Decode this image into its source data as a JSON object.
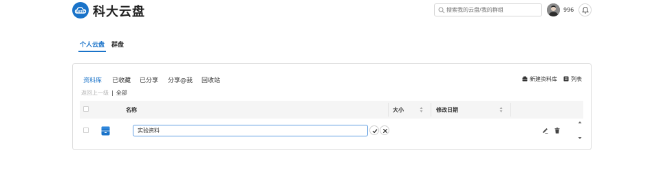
{
  "app": {
    "title": "科大云盘",
    "logo_icon": "cloud-disk-icon",
    "accent_color": "#1a73c9"
  },
  "header": {
    "search_placeholder": "搜索我的云盘/我的群组",
    "username": "996",
    "notification_icon": "bell-icon"
  },
  "top_tabs": [
    {
      "label": "个人云盘",
      "active": true
    },
    {
      "label": "群盘",
      "active": false
    }
  ],
  "sub_tabs": [
    {
      "label": "资料库",
      "active": true
    },
    {
      "label": "已收藏",
      "active": false
    },
    {
      "label": "已分享",
      "active": false
    },
    {
      "label": "分享@我",
      "active": false
    },
    {
      "label": "回收站",
      "active": false
    }
  ],
  "toolbar": {
    "new_library_label": "新建资料库",
    "list_view_label": "列表"
  },
  "breadcrumb": {
    "back_label": "返回上一级",
    "separator": "|",
    "current_label": "全部"
  },
  "table": {
    "columns": {
      "name": "名称",
      "size": "大小",
      "modified": "修改日期"
    },
    "rows": [
      {
        "name_value": "实验资料",
        "editing": true
      }
    ]
  }
}
